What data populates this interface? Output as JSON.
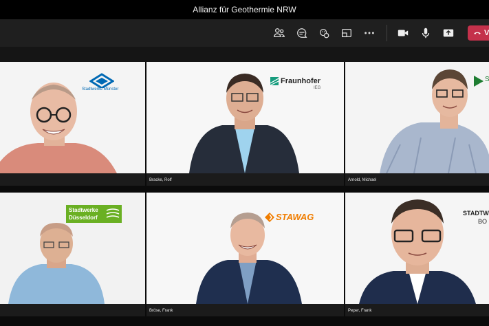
{
  "window": {
    "title": "Allianz für Geothermie NRW"
  },
  "toolbar": {
    "leave_label": "V",
    "buttons": [
      {
        "icon": "people-icon"
      },
      {
        "icon": "chat-icon"
      },
      {
        "icon": "reactions-icon"
      },
      {
        "icon": "rooms-icon"
      },
      {
        "icon": "more-icon"
      },
      {
        "icon": "camera-icon"
      },
      {
        "icon": "mic-icon"
      },
      {
        "icon": "share-icon"
      }
    ]
  },
  "tiles": [
    {
      "name": "",
      "logo": "Stadtwerke Münster"
    },
    {
      "name": "Bracke, Rolf",
      "logo": "Fraunhofer",
      "logo_sub": "IEG"
    },
    {
      "name": "Arnold, Michael",
      "logo": "S"
    },
    {
      "name": "",
      "logo_line1": "Stadtwerke",
      "logo_line2": "Düsseldorf"
    },
    {
      "name": "Bröse, Frank",
      "logo": "STAWAG"
    },
    {
      "name": "Peper, Frank",
      "logo_line1": "STADTW",
      "logo_line2": "BO"
    }
  ],
  "colors": {
    "toolbar_bg": "#1f1f1f",
    "leave_red": "#c4314b",
    "fraunhofer_green": "#179c7d",
    "stawag_orange": "#f07d00",
    "duesseldorf_green": "#6ab023",
    "muenster_blue": "#0069b4"
  }
}
